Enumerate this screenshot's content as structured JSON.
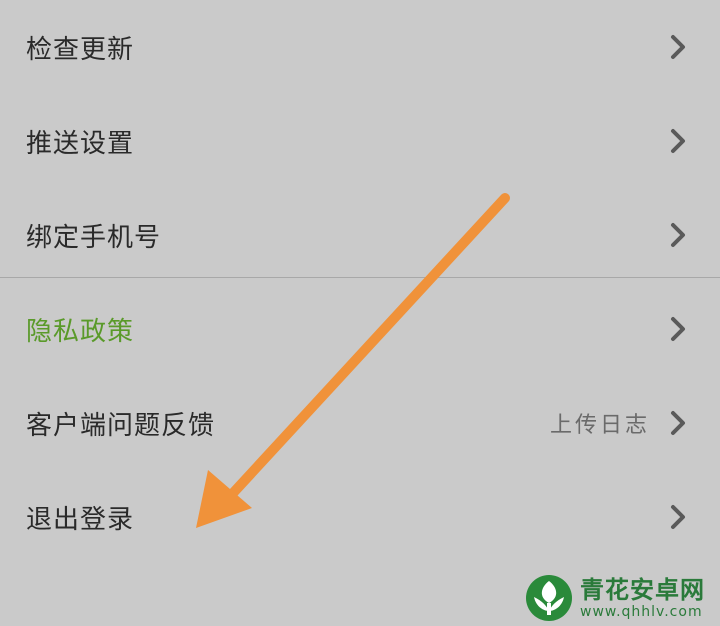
{
  "settings": {
    "items": [
      {
        "label": "检查更新"
      },
      {
        "label": "推送设置"
      },
      {
        "label": "绑定手机号"
      },
      {
        "label": "隐私政策",
        "highlight_color": "#5a9a2a"
      },
      {
        "label": "客户端问题反馈",
        "value": "上传日志"
      },
      {
        "label": "退出登录"
      }
    ]
  },
  "annotation": {
    "arrow_color": "#f0923a",
    "arrow_icon": "arrow-down-left-icon"
  },
  "watermark": {
    "title": "青花安卓网",
    "url": "www.qhhlv.com"
  }
}
